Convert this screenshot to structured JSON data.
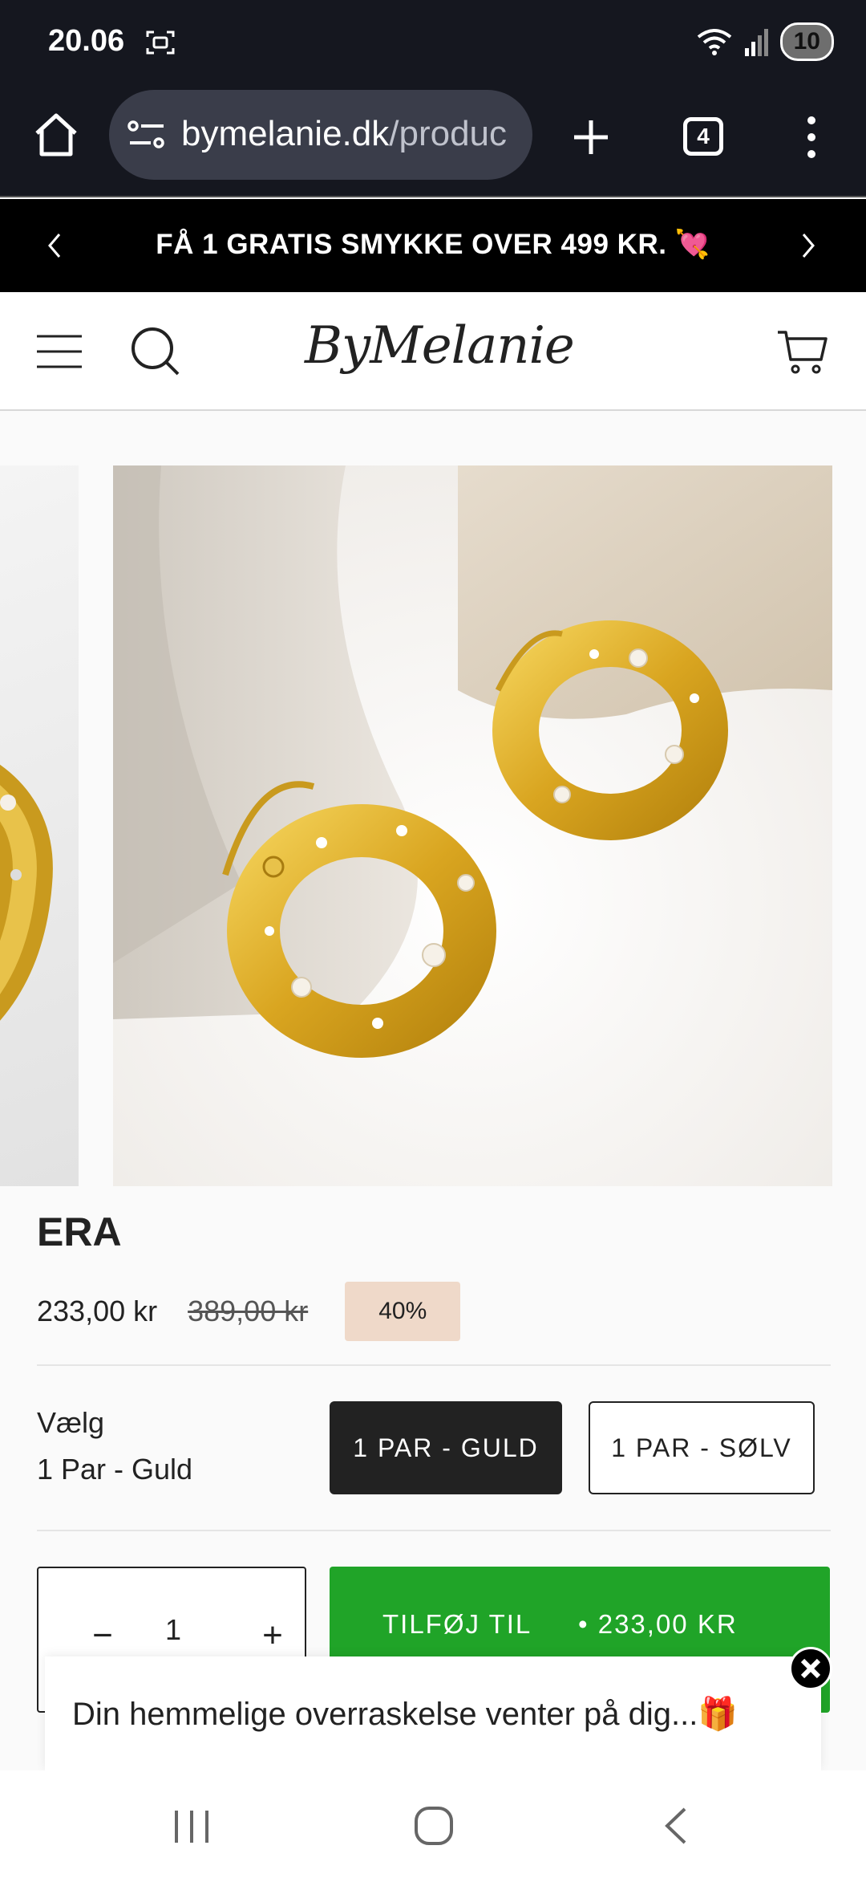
{
  "status_bar": {
    "time": "20.06",
    "battery": "10"
  },
  "browser": {
    "url_host": "bymelanie.dk",
    "url_rest": "/produc",
    "tab_count": "4"
  },
  "announcement": {
    "text": "FÅ 1 GRATIS SMYKKE OVER 499 KR. 💘"
  },
  "store": {
    "logo": "ByMelanie"
  },
  "product": {
    "title": "ERA",
    "price": "233,00 kr",
    "compare_price": "389,00 kr",
    "discount_badge": "40%"
  },
  "variant": {
    "label": "Vælg",
    "selected_value": "1 Par - Guld",
    "options": [
      "1 PAR - GULD",
      "1 PAR - SØLV"
    ]
  },
  "quantity": {
    "value": "1"
  },
  "add_to_cart": {
    "label": "TILFØJ TIL KURV",
    "price": "• 233,00 KR"
  },
  "popup": {
    "text": "Din hemmelige overraskelse venter på dig...🎁"
  },
  "colors": {
    "add_to_cart_bg": "#20a428",
    "badge_bg": "#efd9c9",
    "selected_variant_bg": "#222222"
  }
}
